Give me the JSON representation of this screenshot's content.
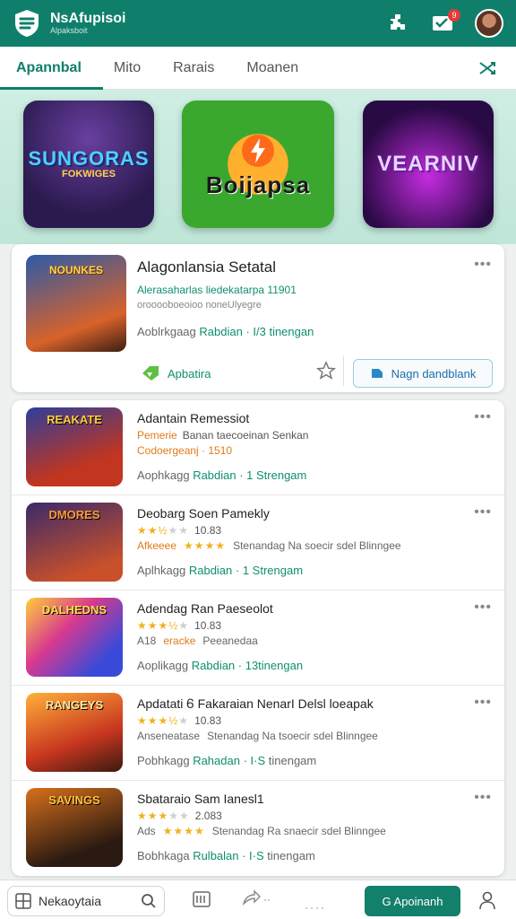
{
  "header": {
    "app_name": "NsAfupisoi",
    "app_sub": "Alpaksboit",
    "notification_count": "9"
  },
  "tabs": [
    "Apannbal",
    "Mito",
    "Rarais",
    "Moanen"
  ],
  "featured_banners": [
    {
      "title": "SUNGORAS",
      "subtitle": "FOKWIGES"
    },
    {
      "title": "Boijapsa",
      "subtitle": ""
    },
    {
      "title": "VEARNIV",
      "subtitle": ""
    }
  ],
  "featured_card": {
    "thumb_text": "NOUNKES",
    "title": "Alagonlansia Setatal",
    "line1": "Alerasaharlas liedekatarpa 11901",
    "line2": "orooooboeoioo noneUlyegre",
    "meta_prefix": "Aoblrkgaag",
    "meta_green": "Rabdian · I/3 tinengan",
    "category": "Apbatira",
    "download_label": "Nagn dandblank",
    "more": "•••"
  },
  "list": [
    {
      "thumb": "REAKATE",
      "title": "Adantain Remessiot",
      "line2_orange": "Pemerie",
      "line2": "Banan taecoeinan Senkan",
      "line3": "Codoergeanj · 1510",
      "rating": null,
      "meta_prefix": "Aophkagg",
      "meta_green": "Rabdian · 1 Strengam"
    },
    {
      "thumb": "DMORES",
      "title": "Deobarg Soen Pamekly",
      "rating": "2.5",
      "rating_text": "10.83",
      "line3a": "Afkeeee",
      "line3b": "Stenandag Na soecir sdel Blinngee",
      "meta_prefix": "Aplhkagg",
      "meta_green": "Rabdian · 1 Strengam"
    },
    {
      "thumb": "DALHEDNS",
      "title": "Adendag Ran Paeseolot",
      "rating": "3.5",
      "rating_text": "10.83",
      "line3a": "A18",
      "line3b": "Peeanedaa",
      "line3_orange": "eracke",
      "meta_prefix": "Aoplikagg",
      "meta_green": "Rabdian · 13tinengan"
    },
    {
      "thumb": "RANGEYS",
      "title": "Apdatati Ꮾ Fakaraian NenarI Delsl loeapak",
      "rating": "3.5",
      "rating_text": "10.83",
      "line3a": "Anseneatase",
      "line3b": "Stenandag Na tsoecir sdel Blinngee",
      "meta_prefix": "Pobhkagg",
      "meta_green": "Rahadan · I·S",
      "meta_suffix": "tinengam"
    },
    {
      "thumb": "SAVINGS",
      "title": "Sbataraio Sam Ianesl1",
      "rating": "3",
      "rating_text": "2.083",
      "line3a": "Ads",
      "line3b": "Stenandag Ra snaecir sdel Blinngee",
      "meta_prefix": "Bobhkaga",
      "meta_green": "Rulbalan · I·S",
      "meta_suffix": "tinengam"
    }
  ],
  "bottom": {
    "search_placeholder": "Nekaoytaia",
    "cta_label": "G Apoinanh"
  }
}
